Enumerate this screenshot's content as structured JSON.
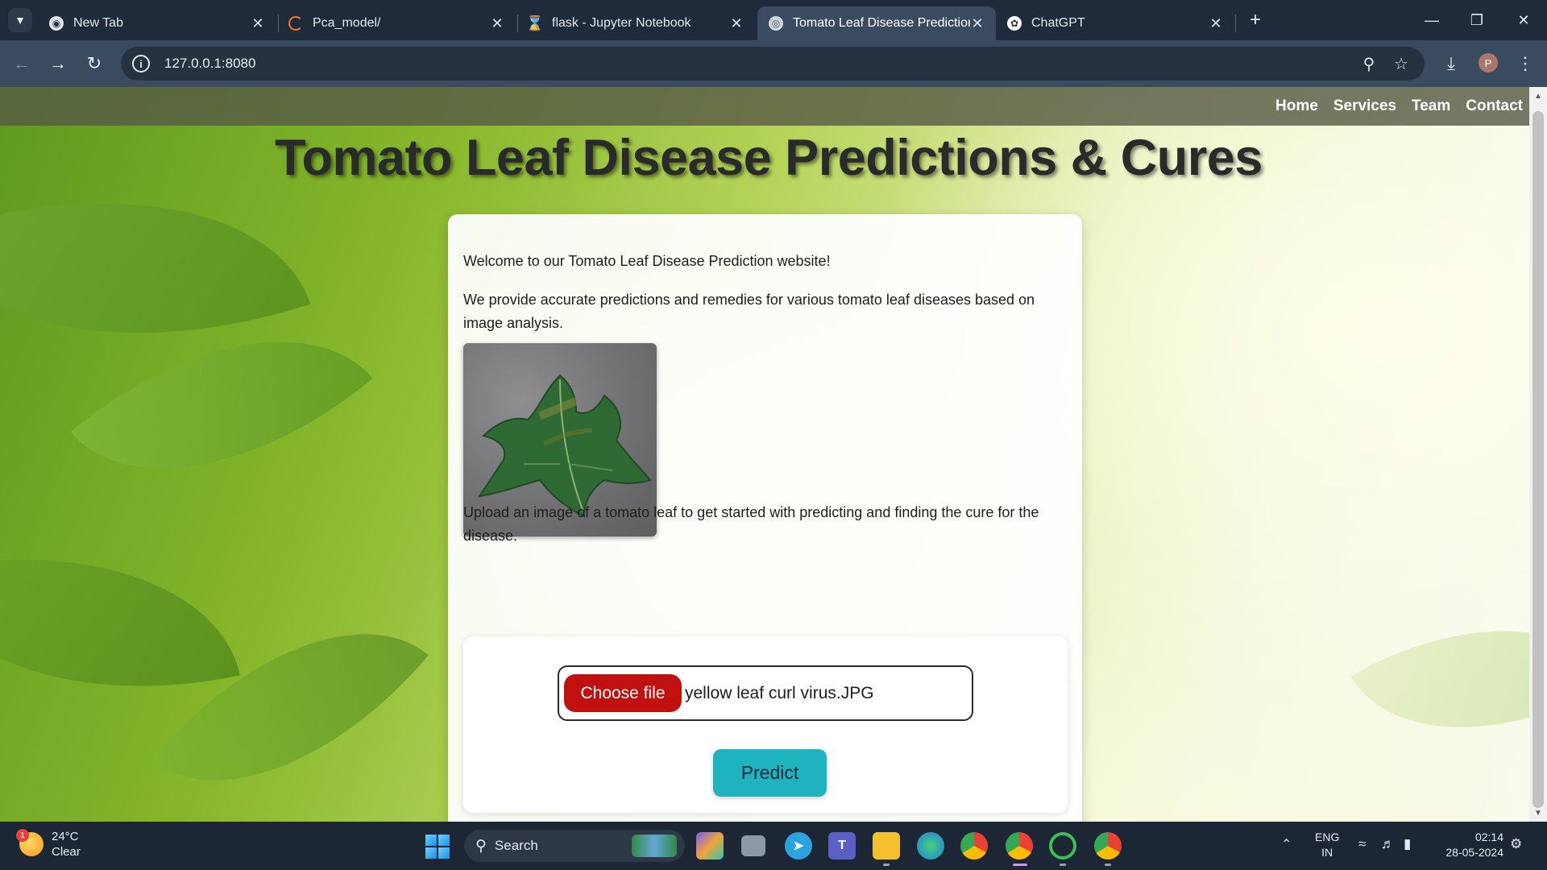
{
  "browser": {
    "tabs": [
      {
        "title": "New Tab",
        "icon": "chrome-icon"
      },
      {
        "title": "Pca_model/",
        "icon": "jupyter-icon"
      },
      {
        "title": "flask - Jupyter Notebook",
        "icon": "hourglass-icon"
      },
      {
        "title": "Tomato Leaf Disease Prediction",
        "icon": "globe-icon",
        "active": true
      },
      {
        "title": "ChatGPT",
        "icon": "chatgpt-icon"
      }
    ],
    "url": "127.0.0.1:8080",
    "profile_initial": "P"
  },
  "site": {
    "nav": [
      "Home",
      "Services",
      "Team",
      "Contact"
    ],
    "title": "Tomato Leaf Disease Predictions & Cures",
    "welcome": "Welcome to our Tomato Leaf Disease Prediction website!",
    "intro": "We provide accurate predictions and remedies for various tomato leaf diseases based on image analysis.",
    "upload_prompt": "Upload an image of a tomato leaf to get started with predicting and finding the cure for the disease.",
    "choose_file_label": "Choose file",
    "file_name": "yellow leaf curl virus.JPG",
    "predict_label": "Predict"
  },
  "taskbar": {
    "weather_temp": "24°C",
    "weather_desc": "Clear",
    "weather_badge": "1",
    "search_placeholder": "Search",
    "lang_line1": "ENG",
    "lang_line2": "IN",
    "time": "02:14",
    "date": "28-05-2024"
  }
}
